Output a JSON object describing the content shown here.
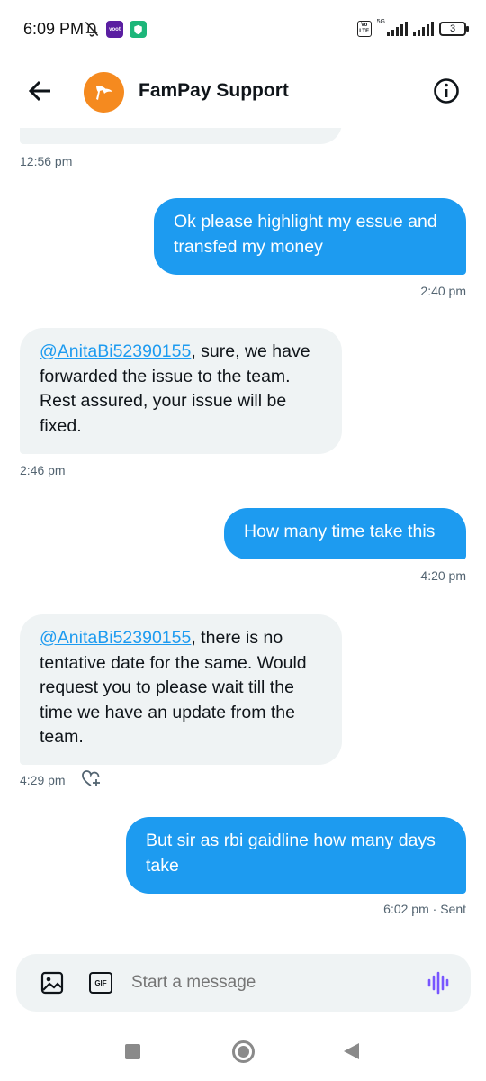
{
  "status_bar": {
    "time": "6:09 PM",
    "voot_label": "voot",
    "volte_label": "Vo LTE",
    "network_label": "5G",
    "battery_level": "3",
    "icons": [
      "bell-off-icon",
      "voot-app-icon",
      "shield-app-icon",
      "signal-icon",
      "battery-icon"
    ]
  },
  "header": {
    "title": "FamPay Support",
    "back_icon": "arrow-left-icon",
    "info_icon": "info-circle-icon",
    "avatar_color": "#f58a1f"
  },
  "colors": {
    "accent": "#1d9bf0",
    "incoming_bubble": "#eff3f4",
    "muted_text": "#536471"
  },
  "messages": [
    {
      "direction": "in",
      "text": "",
      "time": "12:56 pm"
    },
    {
      "direction": "out",
      "text": "Ok please highlight my essue and transfed my money",
      "time": "2:40 pm"
    },
    {
      "direction": "in",
      "mention": "@AnitaBi52390155",
      "text": ", sure, we have forwarded the issue to the team. Rest assured, your issue will be fixed.",
      "time": "2:46 pm"
    },
    {
      "direction": "out",
      "text": "How many time take this",
      "time": "4:20 pm"
    },
    {
      "direction": "in",
      "mention": "@AnitaBi52390155",
      "text": ", there is no tentative date for the same. Would request you to please wait till the time we have an update from the team.",
      "time": "4:29 pm"
    },
    {
      "direction": "out",
      "text": "But sir as rbi gaidline how many days take",
      "time": "6:02 pm · Sent"
    }
  ],
  "composer": {
    "placeholder": "Start a message",
    "gif_label": "GIF",
    "icons": [
      "image-icon",
      "gif-icon",
      "voice-icon"
    ]
  },
  "nav_bar": {
    "icons": [
      "recents-square-icon",
      "home-circle-icon",
      "back-triangle-icon"
    ]
  }
}
